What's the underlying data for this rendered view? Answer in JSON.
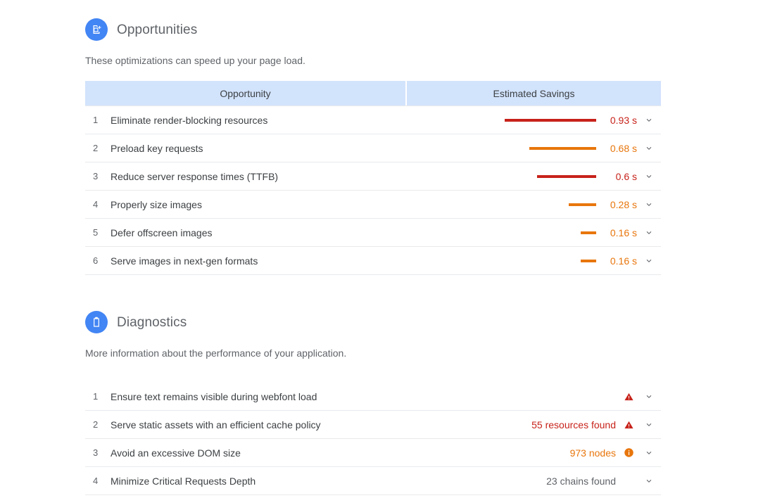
{
  "sections": [
    {
      "id": "opportunities",
      "icon": "document-add-icon",
      "title": "Opportunities",
      "description": "These optimizations can speed up your page load.",
      "columns": {
        "opportunity": "Opportunity",
        "savings": "Estimated Savings"
      },
      "rows": [
        {
          "index": "1",
          "label": "Eliminate render-blocking resources",
          "value": "0.93 s",
          "bar_ratio": 1.0,
          "color": "#c7221a",
          "chevron": "chevron-down-icon"
        },
        {
          "index": "2",
          "label": "Preload key requests",
          "value": "0.68 s",
          "bar_ratio": 0.731,
          "color": "#e8760c",
          "chevron": "chevron-down-icon"
        },
        {
          "index": "3",
          "label": "Reduce server response times (TTFB)",
          "value": "0.6 s",
          "bar_ratio": 0.645,
          "color": "#c7221a",
          "chevron": "chevron-down-icon"
        },
        {
          "index": "4",
          "label": "Properly size images",
          "value": "0.28 s",
          "bar_ratio": 0.301,
          "color": "#e8760c",
          "chevron": "chevron-down-icon"
        },
        {
          "index": "5",
          "label": "Defer offscreen images",
          "value": "0.16 s",
          "bar_ratio": 0.172,
          "color": "#e8760c",
          "chevron": "chevron-down-icon"
        },
        {
          "index": "6",
          "label": "Serve images in next-gen formats",
          "value": "0.16 s",
          "bar_ratio": 0.172,
          "color": "#e8760c",
          "chevron": "chevron-down-icon"
        }
      ]
    },
    {
      "id": "diagnostics",
      "icon": "clipboard-icon",
      "title": "Diagnostics",
      "description": "More information about the performance of your application.",
      "rows": [
        {
          "index": "1",
          "label": "Ensure text remains visible during webfont load",
          "value": "",
          "value_color": "#c7221a",
          "status": "warning-triangle-icon",
          "status_color": "#c7221a",
          "chevron": "chevron-down-icon"
        },
        {
          "index": "2",
          "label": "Serve static assets with an efficient cache policy",
          "value": "55 resources found",
          "value_color": "#c7221a",
          "status": "warning-triangle-icon",
          "status_color": "#c7221a",
          "chevron": "chevron-down-icon"
        },
        {
          "index": "3",
          "label": "Avoid an excessive DOM size",
          "value": "973 nodes",
          "value_color": "#e8760c",
          "status": "info-circle-icon",
          "status_color": "#e8760c",
          "chevron": "chevron-down-icon"
        },
        {
          "index": "4",
          "label": "Minimize Critical Requests Depth",
          "value": "23 chains found",
          "value_color": "#5f6368",
          "status": "none",
          "status_color": "",
          "chevron": "chevron-down-icon"
        }
      ]
    }
  ],
  "theme": {
    "accent_blue": "#4285f4",
    "header_bg": "#d2e3fc",
    "red": "#c7221a",
    "orange": "#e8760c",
    "gray_text": "#5f6368",
    "dark_text": "#3c4043",
    "divider": "#e8eaed"
  }
}
